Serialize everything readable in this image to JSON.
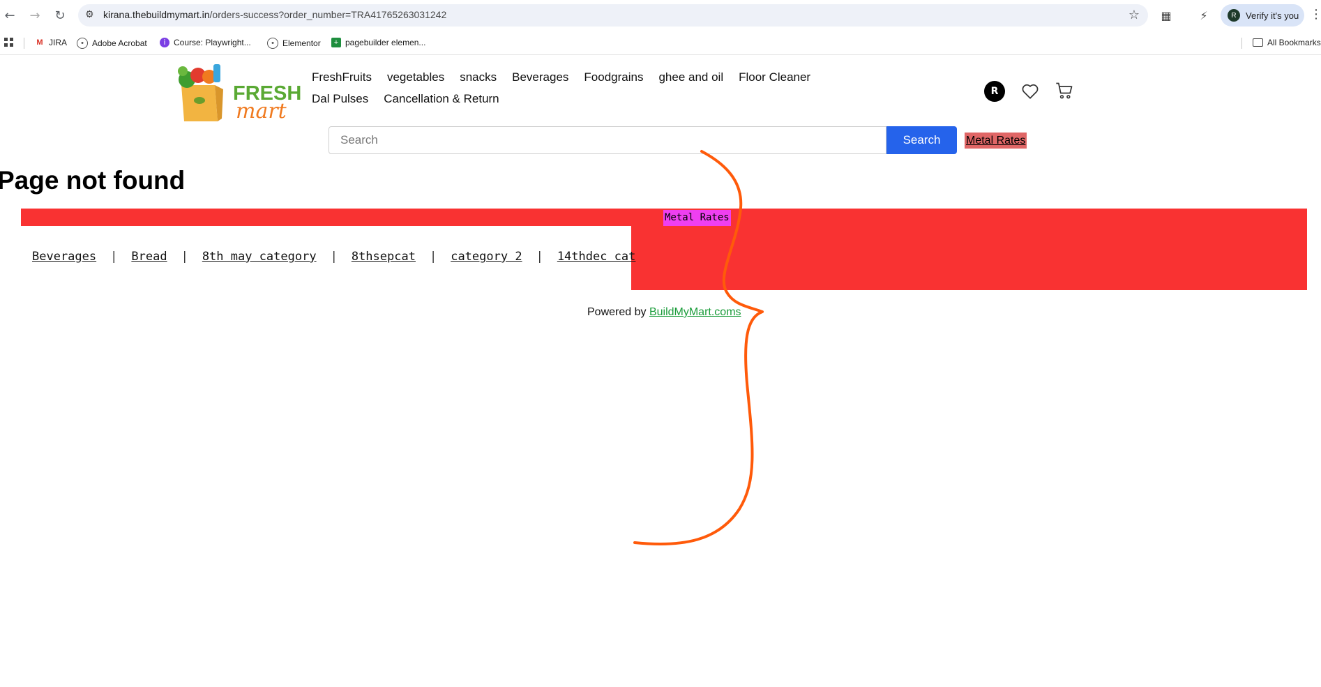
{
  "browser": {
    "url_host": "kirana.thebuildmymart.in",
    "url_rest": "/orders-success?order_number=TRA41765263031242",
    "verify_label": "Verify it's you",
    "bookmarks": [
      {
        "label": "JIRA",
        "icon": "gmail-icon"
      },
      {
        "label": "Adobe Acrobat",
        "icon": "globe-icon"
      },
      {
        "label": "Course: Playwright...",
        "icon": "course-icon"
      },
      {
        "label": "Elementor",
        "icon": "globe-icon"
      },
      {
        "label": "pagebuilder elemen...",
        "icon": "sheets-icon"
      }
    ],
    "all_bookmarks": "All Bookmarks"
  },
  "header": {
    "logo_text_1": "FRESH",
    "logo_text_2": "mart",
    "nav": [
      "FreshFruits",
      "vegetables",
      "snacks",
      "Beverages",
      "Foodgrains",
      "ghee and oil",
      "Floor Cleaner",
      "Dal Pulses",
      "Cancellation & Return"
    ],
    "user_initial": "R",
    "search_placeholder": "Search",
    "search_button": "Search",
    "metal_rates": "Metal Rates"
  },
  "main": {
    "title": "Page not found",
    "metal_rates_banner": "Metal Rates",
    "categories": [
      "Beverages",
      "Bread",
      "8th may category",
      "8thsepcat",
      "category 2",
      "14thdec cat"
    ],
    "powered_prefix": "Powered by ",
    "powered_link": "BuildMyMart.coms"
  },
  "colors": {
    "accent_blue": "#2563eb",
    "banner_red": "#f93232",
    "metal_pink": "#ef3ff1",
    "metal_salmon": "#e06666",
    "powered_green": "#1a9c3a",
    "annotation_orange": "#ff5a0a"
  }
}
